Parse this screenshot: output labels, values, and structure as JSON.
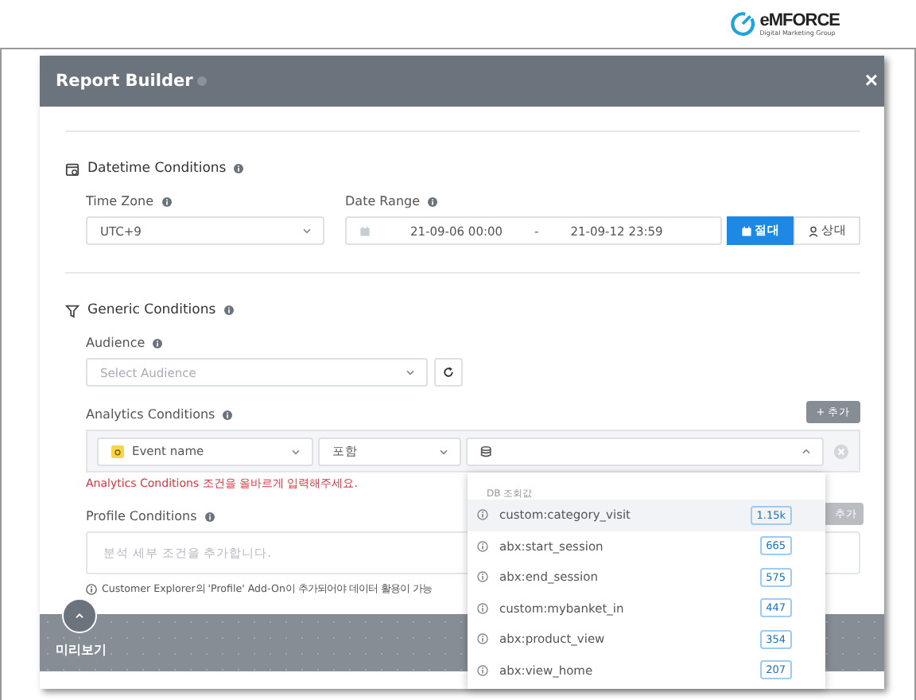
{
  "logo": {
    "name": "eMFORCE",
    "tagline": "Digital Marketing Group"
  },
  "modal": {
    "title": "Report Builder",
    "close": "×"
  },
  "datetime": {
    "title": "Datetime Conditions",
    "time_zone": {
      "label": "Time Zone",
      "value": "UTC+9"
    },
    "date_range": {
      "label": "Date Range",
      "start": "21-09-06 00:00",
      "separator": "-",
      "end": "21-09-12 23:59"
    },
    "modes": [
      {
        "label": "절대",
        "kind": "calendar",
        "selected": true
      },
      {
        "label": "상대",
        "kind": "person",
        "selected": false
      }
    ]
  },
  "generic": {
    "title": "Generic Conditions",
    "audience": {
      "label": "Audience",
      "placeholder": "Select Audience"
    },
    "analytics": {
      "label": "Analytics Conditions",
      "add_button": "+ 추가",
      "field": "Event name",
      "operator": "포함",
      "error": "Analytics Conditions 조건을 올바르게 입력해주세요."
    },
    "profile": {
      "label": "Profile Conditions",
      "add_button": "추가",
      "placeholder": "분석 세부 조건을 추가합니다.",
      "note": "Customer Explorer의 'Profile' Add-On이 추가되어야 데이터 활용이 가능"
    }
  },
  "dropdown": {
    "header": "DB 조회값",
    "options": [
      {
        "name": "custom:category_visit",
        "count": "1.15k",
        "selected": true
      },
      {
        "name": "abx:start_session",
        "count": "665",
        "selected": false
      },
      {
        "name": "abx:end_session",
        "count": "575",
        "selected": false
      },
      {
        "name": "custom:mybanket_in",
        "count": "447",
        "selected": false
      },
      {
        "name": "abx:product_view",
        "count": "354",
        "selected": false
      },
      {
        "name": "abx:view_home",
        "count": "207",
        "selected": false
      }
    ]
  },
  "footer": {
    "title": "미리보기"
  }
}
